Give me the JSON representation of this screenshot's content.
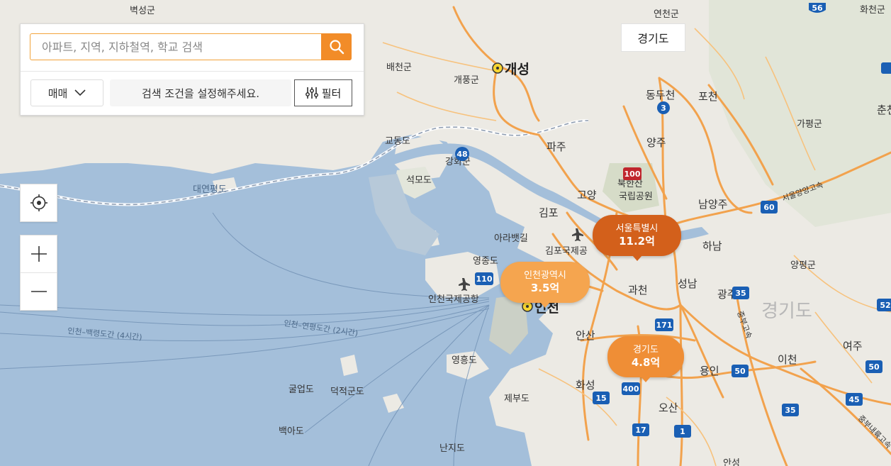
{
  "search": {
    "placeholder": "아파트, 지역, 지하철역, 학교 검색",
    "deal_type": "매매",
    "condition_text": "검색 조건을 설정해주세요.",
    "filter_label": "필터"
  },
  "region_chip": "경기도",
  "markers": [
    {
      "name": "서울특별시",
      "price": "11.2억",
      "color": "#d3601b"
    },
    {
      "name": "인천광역시",
      "price": "3.5억",
      "color": "#f5a54f"
    },
    {
      "name": "경기도",
      "price": "4.8억",
      "color": "#ef8e36"
    }
  ],
  "map_labels": {
    "cities_major": [
      "개성",
      "인천"
    ],
    "cities": [
      "파주",
      "양주",
      "동두천",
      "포천",
      "고양",
      "김포",
      "남양주",
      "하남",
      "과천",
      "성남",
      "광주",
      "안산",
      "화성",
      "오산",
      "용인",
      "이천",
      "여주",
      "가평군",
      "양평군",
      "춘천"
    ],
    "small": [
      "벽성군",
      "배천군",
      "개풍군",
      "연천군",
      "화천군",
      "교동도",
      "강화군",
      "석모도",
      "대연평도",
      "영종도",
      "인천국제공항",
      "아라뱃길",
      "김포국제공항",
      "북한산국립공원",
      "영흥도",
      "굴업도",
      "덕적군도",
      "백아도",
      "제부도",
      "난지도",
      "안성"
    ],
    "province": "경기도",
    "ferry_routes": [
      "인천–연평도간 (2시간)",
      "인천–백령도간 (4시간)"
    ],
    "highway_names": [
      "서울양양고속",
      "중부고속",
      "중부내륙고속"
    ]
  },
  "road_shields": [
    "56",
    "3",
    "100",
    "60",
    "48",
    "110",
    "171",
    "35",
    "52",
    "50",
    "400",
    "15",
    "17",
    "1",
    "45"
  ],
  "icons": [
    "search-icon",
    "chevron-down-icon",
    "filter-sliders-icon",
    "locate-icon",
    "zoom-in-icon",
    "zoom-out-icon",
    "airport-icon"
  ]
}
